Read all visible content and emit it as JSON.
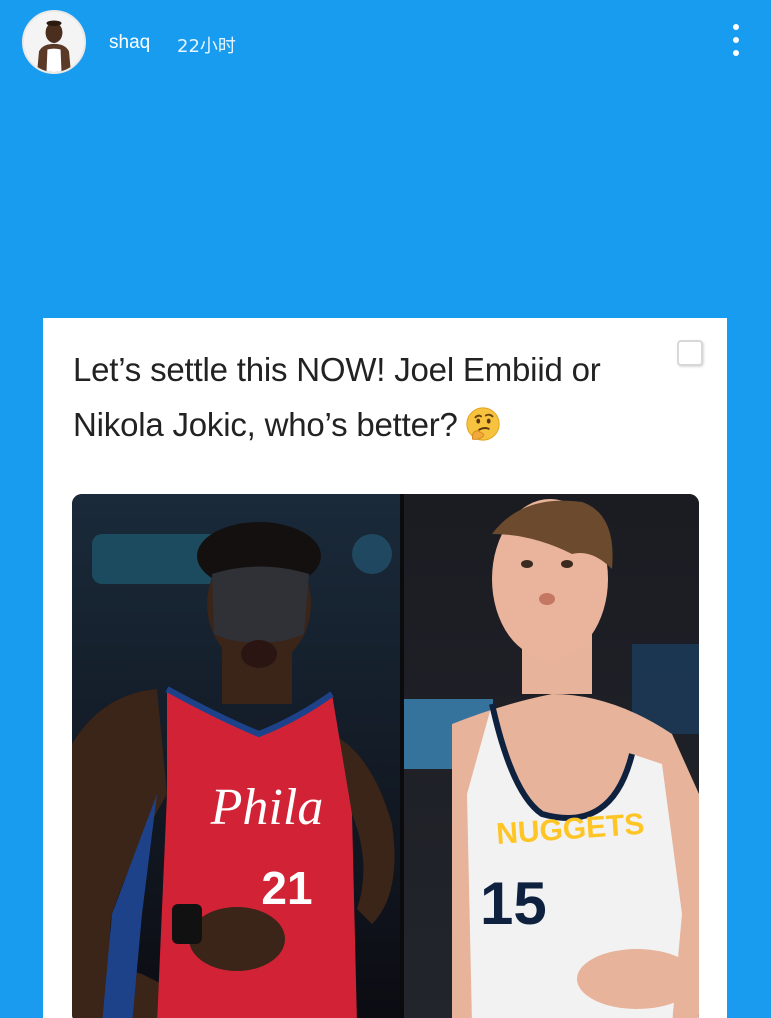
{
  "story": {
    "background_color": "#179cf0",
    "username": "shaq",
    "time_ago": "22小时",
    "more_icon": "more-vertical-icon"
  },
  "post": {
    "text_line1": "Let’s settle this NOW! Joel Embiid or",
    "text_line2": "Nikola Jokic, who’s better?",
    "emoji": "thinking-face",
    "photo": {
      "left_player": {
        "jersey_text": "Phila",
        "jersey_number": "21",
        "jersey_color": "#d22336",
        "trim_color": "#1d428a"
      },
      "right_player": {
        "jersey_text": "NUGGETS",
        "jersey_number": "15",
        "jersey_color": "#f2f2f2",
        "trim_color": "#0e2240",
        "accent_color": "#fec524"
      }
    }
  }
}
